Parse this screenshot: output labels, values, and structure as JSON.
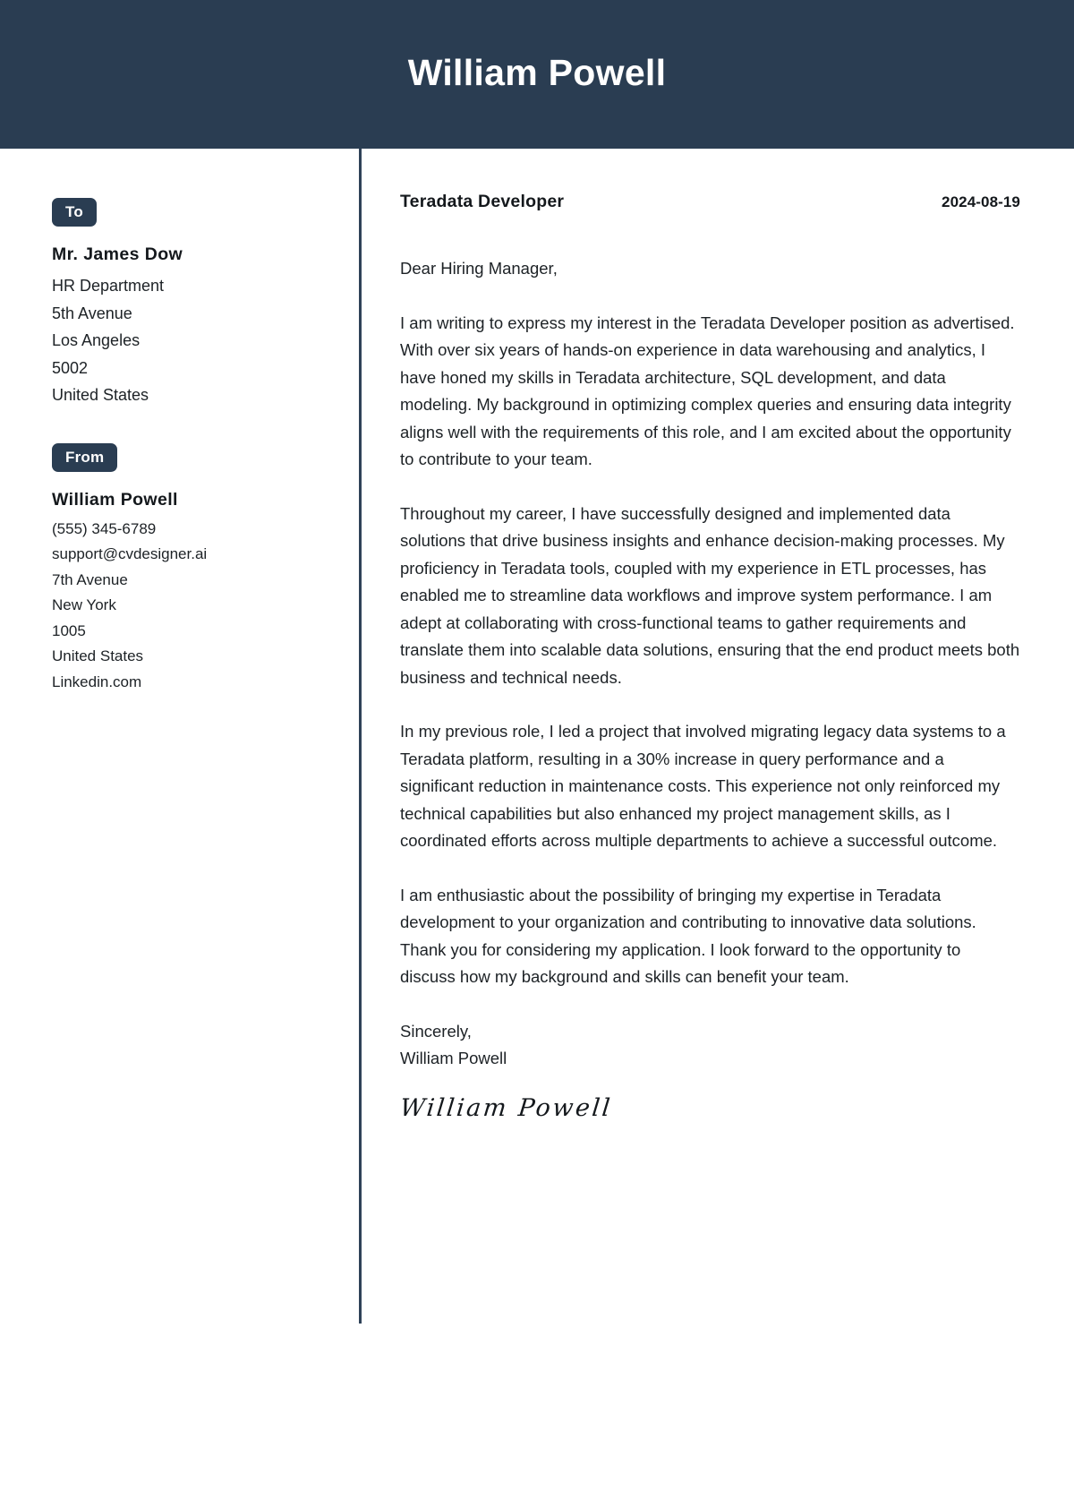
{
  "header": {
    "full_name": "William Powell",
    "background_color": "#2a3d52"
  },
  "sidebar": {
    "to": {
      "badge_label": "To",
      "recipient_name": "Mr. James Dow",
      "lines": [
        "HR Department",
        "5th Avenue",
        "Los Angeles",
        "5002",
        "United States"
      ]
    },
    "from": {
      "badge_label": "From",
      "sender_name": "William  Powell",
      "lines": [
        "(555) 345-6789",
        "support@cvdesigner.ai",
        "7th Avenue",
        "New York",
        "1005",
        "United States",
        "Linkedin.com"
      ]
    }
  },
  "letter": {
    "job_title": "Teradata Developer",
    "date": "2024-08-19",
    "salutation": "Dear Hiring Manager,",
    "paragraphs": [
      "I am writing to express my interest in the Teradata Developer position as advertised. With over six years of hands-on experience in data warehousing and analytics, I have honed my skills in Teradata architecture, SQL development, and data modeling. My background in optimizing complex queries and ensuring data integrity aligns well with the requirements of this role, and I am excited about the opportunity to contribute to your team.",
      "Throughout my career, I have successfully designed and implemented data solutions that drive business insights and enhance decision-making processes. My proficiency in Teradata tools, coupled with my experience in ETL processes, has enabled me to streamline data workflows and improve system performance. I am adept at collaborating with cross-functional teams to gather requirements and translate them into scalable data solutions, ensuring that the end product meets both business and technical needs.",
      "In my previous role, I led a project that involved migrating legacy data systems to a Teradata platform, resulting in a 30% increase in query performance and a significant reduction in maintenance costs. This experience not only reinforced my technical capabilities but also enhanced my project management skills, as I coordinated efforts across multiple departments to achieve a successful outcome.",
      "I am enthusiastic about the possibility of bringing my expertise in Teradata development to your organization and contributing to innovative data solutions. Thank you for considering my application. I look forward to the opportunity to discuss how my background and skills can benefit your team."
    ],
    "closing_salutation": "Sincerely,",
    "closing_name": "William Powell",
    "signature_text": "William Powell"
  }
}
